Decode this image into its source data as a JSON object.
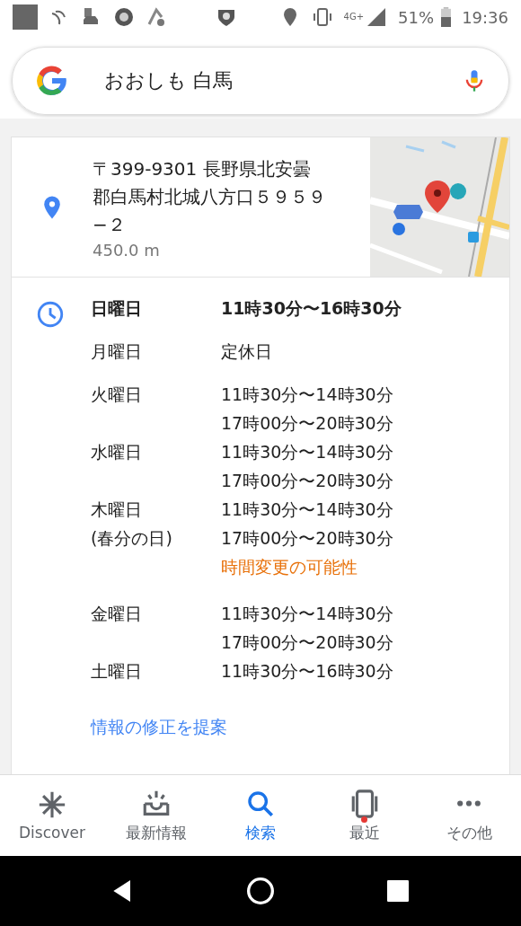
{
  "status_bar": {
    "network": "4G+",
    "battery": "51%",
    "time": "19:36"
  },
  "search": {
    "value": "おおしも 白馬"
  },
  "place": {
    "address": "〒399-9301 長野県北安曇郡白馬村北城八方口５９５９−２",
    "distance": "450.0 m"
  },
  "hours": [
    {
      "day": "日曜日",
      "today": true,
      "times": [
        "11時30分〜16時30分"
      ]
    },
    {
      "day": "月曜日",
      "today": false,
      "times": [
        "定休日"
      ]
    },
    {
      "day": "火曜日",
      "today": false,
      "times": [
        "11時30分〜14時30分",
        "17時00分〜20時30分"
      ]
    },
    {
      "day": "水曜日",
      "today": false,
      "times": [
        "11時30分〜14時30分",
        "17時00分〜20時30分"
      ]
    },
    {
      "day": "木曜日",
      "holiday": "(春分の日)",
      "today": false,
      "times": [
        "11時30分〜14時30分",
        "17時00分〜20時30分"
      ],
      "note": "時間変更の可能性"
    },
    {
      "day": "金曜日",
      "today": false,
      "times": [
        "11時30分〜14時30分",
        "17時00分〜20時30分"
      ]
    },
    {
      "day": "土曜日",
      "today": false,
      "times": [
        "11時30分〜16時30分"
      ]
    }
  ],
  "suggest_edit": "情報の修正を提案",
  "nav": [
    {
      "kind": "discover",
      "label": "Discover",
      "selected": false,
      "badge": false
    },
    {
      "kind": "updates",
      "label": "最新情報",
      "selected": false,
      "badge": false
    },
    {
      "kind": "search",
      "label": "検索",
      "selected": true,
      "badge": false
    },
    {
      "kind": "recent",
      "label": "最近",
      "selected": false,
      "badge": true
    },
    {
      "kind": "more",
      "label": "その他",
      "selected": false,
      "badge": false
    }
  ]
}
